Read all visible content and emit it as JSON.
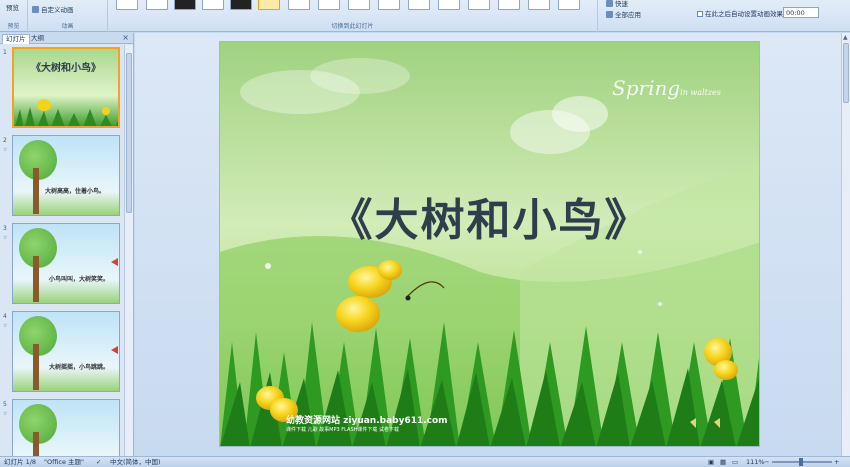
{
  "ribbon": {
    "preview_label": "预览",
    "custom_anim_label": "自定义动画",
    "group_preview": "预览",
    "group_animation": "动画",
    "group_transition": "切换到此幻灯片",
    "apply_all_label": "全部应用",
    "auto_after_label": "在此之后自动设置动画效果:",
    "auto_after_time": "00:00",
    "speed_label": "快速"
  },
  "pane": {
    "tab_slides": "幻灯片",
    "tab_outline": "大纲",
    "close": "×",
    "slides": [
      {
        "num": "1",
        "title": "《大树和小鸟》"
      },
      {
        "num": "2",
        "caption": "大树高高，住着小鸟。"
      },
      {
        "num": "3",
        "caption": "小鸟叫叫，大树笑笑。"
      },
      {
        "num": "4",
        "caption": "大树摇摇，小鸟跳跳。"
      },
      {
        "num": "5",
        "caption": ""
      }
    ]
  },
  "slide": {
    "title": "《大树和小鸟》",
    "spring_text": "Spring",
    "spring_small": "in waltzes",
    "site_text": "幼教资源网站  ziyuan.baby611.com",
    "site_sub": "课件下载  儿歌 故事MP3  FLASH课件下载  试卷下载"
  },
  "status": {
    "slide_count": "幻灯片 1/8",
    "theme": "\"Office 主题\"",
    "language": "中文(简体，中国)",
    "zoom": "111%"
  },
  "colors": {
    "ribbon_bg": "#dbe6f4",
    "accent_selected": "#f0a229",
    "title_color": "#2f3e4c"
  }
}
